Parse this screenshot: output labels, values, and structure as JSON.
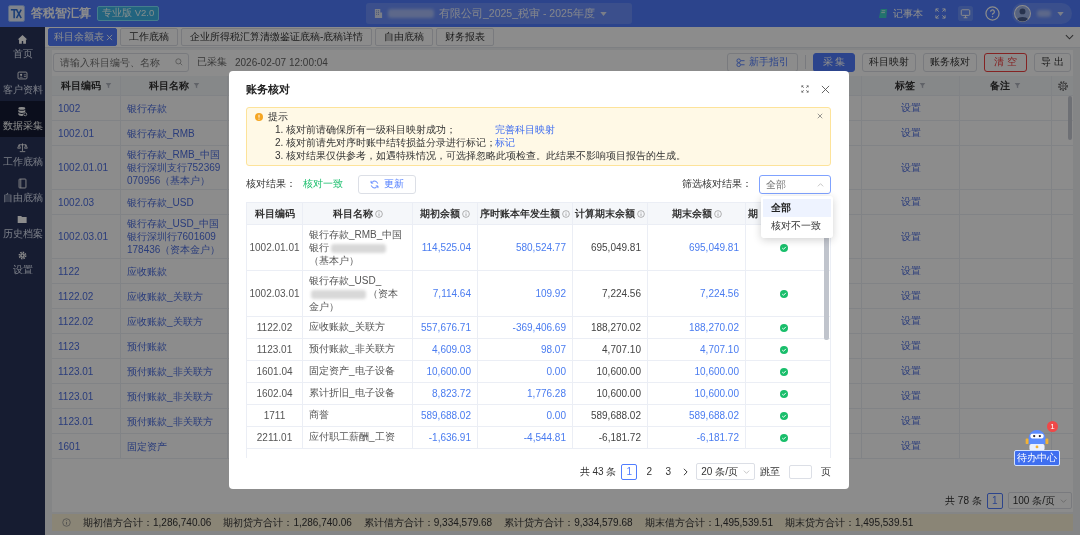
{
  "header": {
    "app_name": "答税智汇算",
    "edition_badge": "专业版 V2.0",
    "company_selector": "有限公司_2025_税审 - 2025年度",
    "notepad": "记事本"
  },
  "sidebar": {
    "items": [
      {
        "label": "首页",
        "kind": "home",
        "selected": false
      },
      {
        "label": "客户资料",
        "kind": "card",
        "selected": false
      },
      {
        "label": "数据采集",
        "kind": "database",
        "selected": true
      },
      {
        "label": "工作底稿",
        "kind": "scale",
        "selected": false
      },
      {
        "label": "自由底稿",
        "kind": "book",
        "selected": false
      },
      {
        "label": "历史档案",
        "kind": "folder",
        "selected": false
      },
      {
        "label": "设置",
        "kind": "gear",
        "selected": false
      }
    ]
  },
  "tabs": [
    {
      "label": "科目余额表",
      "selected": true,
      "closable": true
    },
    {
      "label": "工作底稿",
      "selected": false,
      "closable": false
    },
    {
      "label": "企业所得税汇算清缴鉴证底稿-底稿详情",
      "selected": false,
      "closable": false
    },
    {
      "label": "自由底稿",
      "selected": false,
      "closable": false
    },
    {
      "label": "财务报表",
      "selected": false,
      "closable": false
    }
  ],
  "toolbar": {
    "search_placeholder": "请输入科目编号、名称",
    "collect_status": "已采集",
    "collect_time": "2026-02-07 12:00:04",
    "buttons": [
      {
        "label": "新手指引",
        "kind": "guide"
      },
      {
        "label": "采 集",
        "kind": "primary"
      },
      {
        "label": "科目映射",
        "kind": "default"
      },
      {
        "label": "账务核对",
        "kind": "default"
      },
      {
        "label": "清 空",
        "kind": "danger"
      },
      {
        "label": "导 出",
        "kind": "default"
      }
    ]
  },
  "balance_table": {
    "columns": [
      "科目编码",
      "科目名称",
      "标签",
      "备注"
    ],
    "rows": [
      {
        "code": "1002",
        "name": "银行存款",
        "tag": "设置"
      },
      {
        "code": "1002.01",
        "name": "银行存款_RMB",
        "tag": "设置"
      },
      {
        "code": "1002.01.01",
        "name": "银行存款_RMB_中国银行深圳支行752369070956（基本户）",
        "tag": "设置"
      },
      {
        "code": "1002.03",
        "name": "银行存款_USD",
        "tag": "设置"
      },
      {
        "code": "1002.03.01",
        "name": "银行存款_USD_中国银行深圳行7601609178436（资本金户）",
        "tag": "设置"
      },
      {
        "code": "1122",
        "name": "应收账款",
        "tag": "设置"
      },
      {
        "code": "1122.02",
        "name": "应收账款_关联方",
        "tag": "设置"
      },
      {
        "code": "1122.02",
        "name": "应收账款_关联方",
        "tag": "设置"
      },
      {
        "code": "1123",
        "name": "预付账款",
        "tag": "设置"
      },
      {
        "code": "1123.01",
        "name": "预付账款_非关联方",
        "tag": "设置"
      },
      {
        "code": "1123.01",
        "name": "预付账款_非关联方",
        "tag": "设置"
      },
      {
        "code": "1123.01",
        "name": "预付账款_非关联方",
        "tag": "设置"
      },
      {
        "code": "1601",
        "name": "固定资产",
        "tag": "设置"
      }
    ]
  },
  "pagination": {
    "total": "共 78 条",
    "pages": [
      {
        "label": "1",
        "selected": true
      }
    ],
    "page_size": "100 条/页"
  },
  "totals": [
    "期初借方合计：1,286,740.06",
    "期初贷方合计：1,286,740.06",
    "累计借方合计：9,334,579.68",
    "累计贷方合计：9,334,579.68",
    "期末借方合计：1,495,539.51",
    "期末贷方合计：1,495,539.51"
  ],
  "todo_center": {
    "label": "待办中心",
    "badge": "1"
  },
  "dialog": {
    "title": "账务核对",
    "notice": {
      "title": "提示",
      "lines": [
        {
          "text": "1. 核对前请确保所有一级科目映射成功；",
          "link": "完善科目映射"
        },
        {
          "text": "2. 核对前请先对序时账中结转损益分录进行标记；",
          "link": "标记"
        },
        {
          "text": "3. 核对结果仅供参考，如遇特殊情况，可选择忽略此项检查。此结果不影响项目报告的生成。"
        }
      ]
    },
    "result_label": "核对结果：",
    "result": "核对一致",
    "refresh_button": "更新",
    "filter_label": "筛选核对结果：",
    "filter": {
      "placeholder": "全部",
      "expanded": true,
      "options": [
        {
          "label": "全部",
          "selected": true
        },
        {
          "label": "核对不一致",
          "selected": false
        }
      ]
    },
    "table": {
      "columns": [
        {
          "label": "科目编码",
          "info": false
        },
        {
          "label": "科目名称",
          "info": true
        },
        {
          "label": "期初余额",
          "info": true
        },
        {
          "label": "序时账本年发生额",
          "info": true
        },
        {
          "label": "计算期末余额",
          "info": true
        },
        {
          "label": "期末余额",
          "info": true
        },
        {
          "label": "期",
          "info": false
        }
      ],
      "rows": [
        {
          "code": "1002.01.01",
          "name": "银行存款_RMB_中国银行",
          "redacted": true,
          "name_after": "（基本户）",
          "opening": "114,525.04",
          "journal": "580,524.77",
          "computed": "695,049.81",
          "closing": "695,049.81",
          "matched": true
        },
        {
          "code": "1002.03.01",
          "name": "银行存款_USD_",
          "redacted": true,
          "name_after": "（资本金户）",
          "opening": "7,114.64",
          "journal": "109.92",
          "computed": "7,224.56",
          "closing": "7,224.56",
          "matched": true
        },
        {
          "code": "1122.02",
          "name": "应收账款_关联方",
          "redacted": false,
          "opening": "557,676.71",
          "journal": "-369,406.69",
          "computed": "188,270.02",
          "closing": "188,270.02",
          "matched": true
        },
        {
          "code": "1123.01",
          "name": "预付账款_非关联方",
          "redacted": false,
          "opening": "4,609.03",
          "journal": "98.07",
          "computed": "4,707.10",
          "closing": "4,707.10",
          "matched": true
        },
        {
          "code": "1601.04",
          "name": "固定资产_电子设备",
          "redacted": false,
          "opening": "10,600.00",
          "journal": "0.00",
          "computed": "10,600.00",
          "closing": "10,600.00",
          "matched": true
        },
        {
          "code": "1602.04",
          "name": "累计折旧_电子设备",
          "redacted": false,
          "opening": "8,823.72",
          "journal": "1,776.28",
          "computed": "10,600.00",
          "closing": "10,600.00",
          "matched": true
        },
        {
          "code": "1711",
          "name": "商誉",
          "redacted": false,
          "opening": "589,688.02",
          "journal": "0.00",
          "computed": "589,688.02",
          "closing": "589,688.02",
          "matched": true
        },
        {
          "code": "2211.01",
          "name": "应付职工薪酬_工资",
          "redacted": false,
          "opening": "-1,636.91",
          "journal": "-4,544.81",
          "computed": "-6,181.72",
          "closing": "-6,181.72",
          "matched": true
        }
      ]
    },
    "pagination": {
      "total": "共 43 条",
      "pages": [
        {
          "label": "1",
          "selected": true
        },
        {
          "label": "2",
          "selected": false
        },
        {
          "label": "3",
          "selected": false
        }
      ],
      "page_size": "20 条/页",
      "jump_label": "跳至",
      "page_unit": "页"
    }
  }
}
